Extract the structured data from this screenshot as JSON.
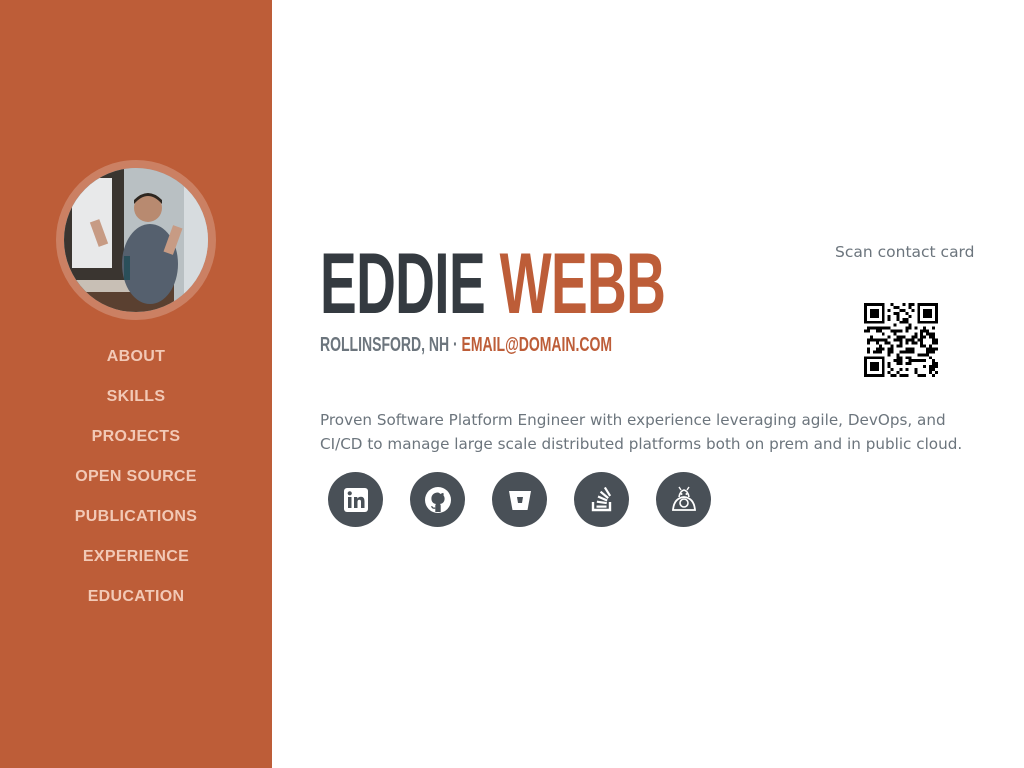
{
  "sidebar": {
    "avatar_alt": "Profile photo",
    "nav": [
      {
        "label": "About"
      },
      {
        "label": "Skills"
      },
      {
        "label": "Projects"
      },
      {
        "label": "Open Source"
      },
      {
        "label": "Publications"
      },
      {
        "label": "Experience"
      },
      {
        "label": "Education"
      }
    ],
    "background_color": "#bd5d38",
    "nav_text_color": "#f2c9b6"
  },
  "profile": {
    "first_name": "Eddie",
    "last_name": "Webb",
    "location": "Rollinsford, NH · ",
    "email": "email@domain.com",
    "summary": "Proven Software Platform Engineer with experience leveraging agile, DevOps, and CI/CD to manage large scale distributed platforms both on prem and in public cloud."
  },
  "social_links": [
    {
      "icon": "linkedin-icon"
    },
    {
      "icon": "github-icon"
    },
    {
      "icon": "bitbucket-icon"
    },
    {
      "icon": "stackoverflow-icon"
    },
    {
      "icon": "hackerrank-icon"
    }
  ],
  "contact_card": {
    "label": "Scan contact card",
    "qr_icon": "qr-code"
  },
  "colors": {
    "accent": "#bd5d38",
    "heading": "#343a40",
    "muted": "#6c757d",
    "social_button": "#495057"
  }
}
